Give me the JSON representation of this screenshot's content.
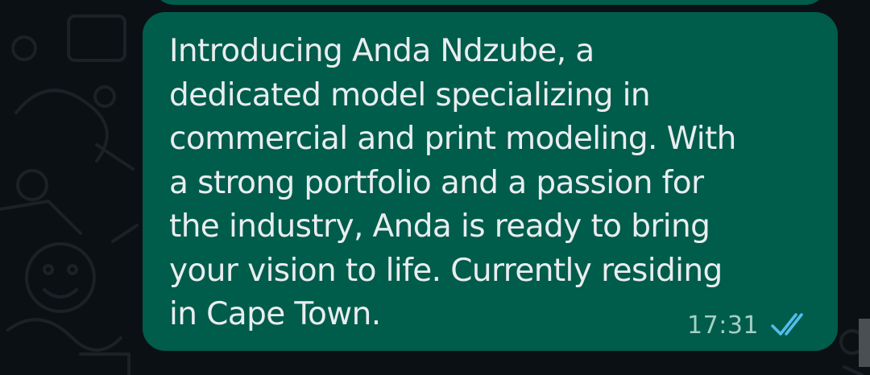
{
  "message": {
    "text": "Introducing Anda Ndzube, a\ndedicated model specializing in\ncommercial and print modeling. With\na strong portfolio and a passion for\nthe industry, Anda is ready to bring\nyour vision to life. Currently residing\nin Cape Town.",
    "time": "17:31",
    "status_icon": "double-check-icon",
    "bubble_color": "#005c4b",
    "text_color": "#e9edef",
    "receipt_color": "#53bdeb"
  },
  "wallpaper": {
    "background_color": "#0b1014",
    "doodle_color": "#1a2226"
  }
}
